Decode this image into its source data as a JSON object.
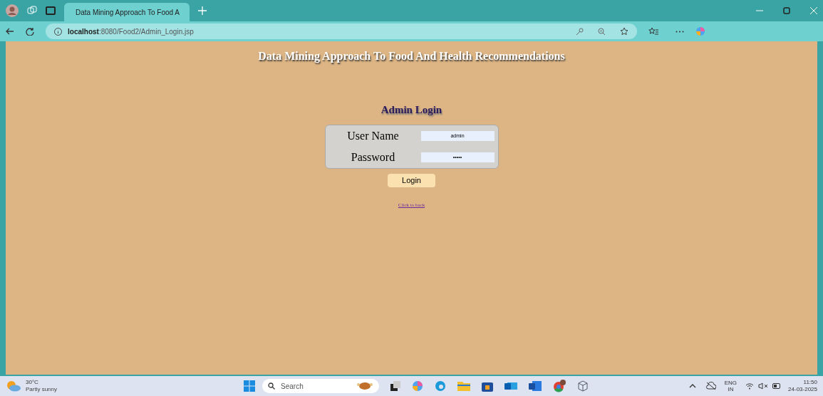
{
  "browser": {
    "tab_title": "Data Mining Approach To Food A",
    "url_host": "localhost",
    "url_path": ":8080/Food2/Admin_Login.jsp"
  },
  "page": {
    "title": "Data Mining Approach To Food And Health Recommendations",
    "heading": "Admin Login",
    "fields": [
      {
        "label": "User Name",
        "value": "admin"
      },
      {
        "label": "Password",
        "value": "•••••"
      }
    ],
    "button": "Login",
    "link": "Click to back"
  },
  "taskbar": {
    "temperature": "30°C",
    "weather": "Partly sunny",
    "search_placeholder": "Search",
    "language": "ENG",
    "region": "IN",
    "time": "11:50",
    "date": "24-03-2025"
  }
}
